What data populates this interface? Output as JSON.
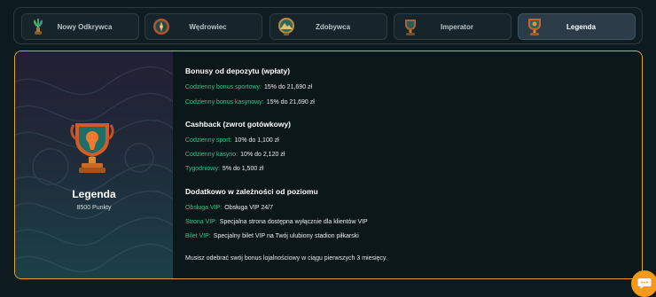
{
  "tabs": [
    {
      "label": "Nowy Odkrywca",
      "icon": "sprout-trophy-icon",
      "active": false
    },
    {
      "label": "Wędrowiec",
      "icon": "compass-badge-icon",
      "active": false
    },
    {
      "label": "Zdobywca",
      "icon": "mountain-badge-icon",
      "active": false
    },
    {
      "label": "Imperator",
      "icon": "cup-trophy-icon",
      "active": false
    },
    {
      "label": "Legenda",
      "icon": "legend-trophy-icon",
      "active": true
    }
  ],
  "rank": {
    "title": "Legenda",
    "points": "8500 Punkty",
    "icon": "legend-trophy-icon"
  },
  "sections": {
    "deposit": {
      "title": "Bonusy od depozytu (wpłaty)",
      "items": [
        {
          "label": "Codzienny bonus sportowy:",
          "value": "15% do 21,690 zł"
        },
        {
          "label": "Codzienny bonus kasynowy:",
          "value": "15% do 21,690 zł"
        }
      ]
    },
    "cashback": {
      "title": "Cashback (zwrot gotówkowy)",
      "items": [
        {
          "label": "Codzienny sport:",
          "value": "10% do 1,100 zł"
        },
        {
          "label": "Codzienny kasyno:",
          "value": "10% do 2,120 zł"
        },
        {
          "label": "Tygodniowy:",
          "value": "5% do 1,500 zł"
        }
      ]
    },
    "extra": {
      "title": "Dodatkowo w zależności od poziomu",
      "items": [
        {
          "label": "Obsługa VIP:",
          "value": "Obsługa VIP 24/7"
        },
        {
          "label": "Strona VIP:",
          "value": "Specjalna strona dostępna wyłącznie dla klientów VIP"
        },
        {
          "label": "Bilet VIP:",
          "value": "Specjalny bilet VIP na Twój ulubiony stadion piłkarski"
        }
      ]
    }
  },
  "note": "Musisz odebrać swój bonus lojalnościowy w ciągu pierwszych 3 miesięcy.",
  "chat": {
    "icon": "chat-bubble-icon"
  },
  "colors": {
    "accent": "#e4a52a",
    "green_label": "#2fc48a",
    "chat": "#f59a16"
  }
}
